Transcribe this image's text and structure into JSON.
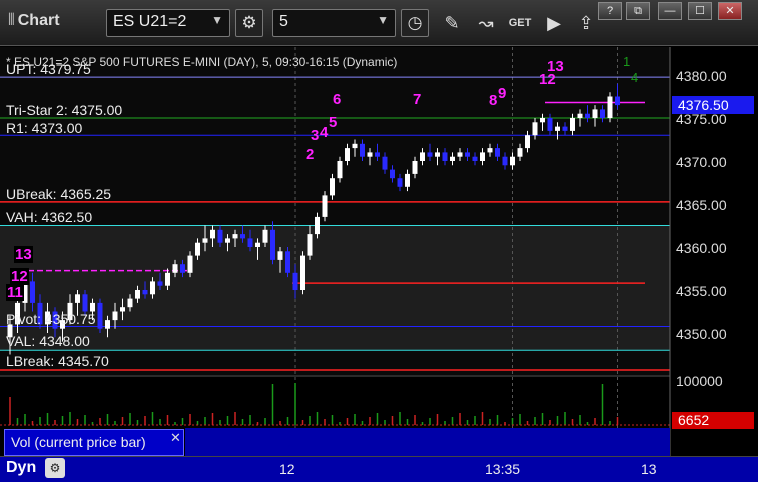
{
  "window": {
    "title": "Chart",
    "title_icon": "columns-icon",
    "controls": [
      "?",
      "⧉",
      "—",
      "☐",
      "✕"
    ]
  },
  "toolbar": {
    "symbol": "ES U21=2",
    "interval": "5",
    "icons": [
      "gear-icon",
      "clock-icon",
      "pencil-icon",
      "study-icon",
      "get-icon",
      "play-icon",
      "export-icon"
    ],
    "get_label": "GET"
  },
  "chart": {
    "title": "* ES U21=2  S&P 500 FUTURES E-MINI (DAY), 5, 09:30-16:15 (Dynamic)",
    "last_price": "4376.50",
    "price_ticks": [
      "4380.00",
      "4375.00",
      "4370.00",
      "4365.00",
      "4360.00",
      "4355.00",
      "4350.00"
    ],
    "levels": [
      {
        "label": "UPT: 4379.75",
        "value": 4379.75,
        "color": "#8888ff"
      },
      {
        "label": "Tri-Star 2: 4375.00",
        "value": 4375.0,
        "color": "#22aa22"
      },
      {
        "label": "R1: 4373.00",
        "value": 4373.0,
        "color": "#2222ff"
      },
      {
        "label": "UBreak: 4365.25",
        "value": 4365.25,
        "color": "#ff2222"
      },
      {
        "label": "VAH: 4362.50",
        "value": 4362.5,
        "color": "#33dddd"
      },
      {
        "label": "Pivot: 4350.75",
        "value": 4350.75,
        "color": "#2222ff"
      },
      {
        "label": "VAL: 4348.00",
        "value": 4348.0,
        "color": "#33dddd"
      },
      {
        "label": "LBreak: 4345.70",
        "value": 4345.7,
        "color": "#ff2222"
      }
    ],
    "sequence_counts": [
      {
        "text": "13",
        "style": "box"
      },
      {
        "text": "12",
        "style": "box"
      },
      {
        "text": "11",
        "style": "box"
      },
      {
        "text": "2",
        "style": "magenta"
      },
      {
        "text": "3",
        "style": "magenta"
      },
      {
        "text": "4",
        "style": "magenta"
      },
      {
        "text": "5",
        "style": "magenta"
      },
      {
        "text": "6",
        "style": "magenta"
      },
      {
        "text": "7",
        "style": "magenta"
      },
      {
        "text": "8",
        "style": "magenta"
      },
      {
        "text": "9",
        "style": "magenta"
      },
      {
        "text": "12",
        "style": "magenta"
      },
      {
        "text": "13",
        "style": "magenta"
      },
      {
        "text": "1",
        "style": "green"
      },
      {
        "text": "4",
        "style": "green"
      }
    ]
  },
  "chart_data": {
    "type": "candlestick",
    "y_unit": "price",
    "ylim": [
      4343,
      4383
    ],
    "ohlc": [
      [
        4349.5,
        4352.0,
        4347.5,
        4351.0
      ],
      [
        4351.0,
        4354.5,
        4350.0,
        4353.5
      ],
      [
        4353.5,
        4357.5,
        4352.5,
        4356.0
      ],
      [
        4356.0,
        4357.0,
        4352.5,
        4353.5
      ],
      [
        4353.5,
        4354.5,
        4350.5,
        4351.0
      ],
      [
        4351.0,
        4353.5,
        4350.0,
        4352.5
      ],
      [
        4352.5,
        4353.0,
        4349.5,
        4350.5
      ],
      [
        4350.5,
        4352.5,
        4349.0,
        4351.5
      ],
      [
        4351.5,
        4354.5,
        4351.0,
        4353.5
      ],
      [
        4353.5,
        4355.0,
        4352.0,
        4354.5
      ],
      [
        4354.5,
        4355.0,
        4352.0,
        4352.5
      ],
      [
        4352.5,
        4354.0,
        4351.5,
        4353.5
      ],
      [
        4353.5,
        4354.0,
        4350.0,
        4350.5
      ],
      [
        4350.5,
        4352.0,
        4349.5,
        4351.5
      ],
      [
        4351.5,
        4353.5,
        4350.5,
        4352.5
      ],
      [
        4352.5,
        4354.0,
        4351.5,
        4353.0
      ],
      [
        4353.0,
        4354.5,
        4352.5,
        4354.0
      ],
      [
        4354.0,
        4355.5,
        4353.5,
        4355.0
      ],
      [
        4355.0,
        4356.0,
        4354.0,
        4354.5
      ],
      [
        4354.5,
        4356.5,
        4354.0,
        4356.0
      ],
      [
        4356.0,
        4357.0,
        4355.0,
        4355.5
      ],
      [
        4355.5,
        4357.5,
        4355.0,
        4357.0
      ],
      [
        4357.0,
        4358.5,
        4356.5,
        4358.0
      ],
      [
        4358.0,
        4358.5,
        4356.5,
        4357.0
      ],
      [
        4357.0,
        4359.5,
        4356.5,
        4359.0
      ],
      [
        4359.0,
        4361.0,
        4358.5,
        4360.5
      ],
      [
        4360.5,
        4362.5,
        4359.5,
        4361.0
      ],
      [
        4361.0,
        4362.5,
        4360.0,
        4362.0
      ],
      [
        4362.0,
        4362.5,
        4360.0,
        4360.5
      ],
      [
        4360.5,
        4361.5,
        4359.5,
        4361.0
      ],
      [
        4361.0,
        4362.0,
        4360.0,
        4361.5
      ],
      [
        4361.5,
        4362.5,
        4360.5,
        4361.0
      ],
      [
        4361.0,
        4362.0,
        4359.5,
        4360.0
      ],
      [
        4360.0,
        4361.0,
        4358.5,
        4360.5
      ],
      [
        4360.5,
        4362.5,
        4360.0,
        4362.0
      ],
      [
        4362.0,
        4363.0,
        4358.0,
        4358.5
      ],
      [
        4358.5,
        4360.0,
        4357.0,
        4359.5
      ],
      [
        4359.5,
        4360.0,
        4356.5,
        4357.0
      ],
      [
        4357.0,
        4358.0,
        4354.0,
        4355.0
      ],
      [
        4355.0,
        4359.5,
        4354.5,
        4359.0
      ],
      [
        4359.0,
        4362.5,
        4358.5,
        4361.5
      ],
      [
        4361.5,
        4364.0,
        4361.0,
        4363.5
      ],
      [
        4363.5,
        4366.5,
        4363.0,
        4366.0
      ],
      [
        4366.0,
        4368.5,
        4365.5,
        4368.0
      ],
      [
        4368.0,
        4370.5,
        4367.5,
        4370.0
      ],
      [
        4370.0,
        4372.0,
        4369.5,
        4371.5
      ],
      [
        4371.5,
        4372.5,
        4370.5,
        4372.0
      ],
      [
        4372.0,
        4372.5,
        4370.0,
        4370.5
      ],
      [
        4370.5,
        4371.5,
        4369.5,
        4371.0
      ],
      [
        4371.0,
        4372.0,
        4370.0,
        4370.5
      ],
      [
        4370.5,
        4371.0,
        4368.5,
        4369.0
      ],
      [
        4369.0,
        4369.5,
        4367.5,
        4368.0
      ],
      [
        4368.0,
        4368.5,
        4366.5,
        4367.0
      ],
      [
        4367.0,
        4369.0,
        4366.5,
        4368.5
      ],
      [
        4368.5,
        4370.5,
        4368.0,
        4370.0
      ],
      [
        4370.0,
        4371.5,
        4369.5,
        4371.0
      ],
      [
        4371.0,
        4372.0,
        4370.0,
        4370.5
      ],
      [
        4370.5,
        4371.5,
        4369.5,
        4371.0
      ],
      [
        4371.0,
        4371.5,
        4369.5,
        4370.0
      ],
      [
        4370.0,
        4371.0,
        4369.5,
        4370.5
      ],
      [
        4370.5,
        4371.5,
        4370.0,
        4371.0
      ],
      [
        4371.0,
        4371.5,
        4370.0,
        4370.5
      ],
      [
        4370.5,
        4371.0,
        4369.5,
        4370.0
      ],
      [
        4370.0,
        4371.5,
        4369.5,
        4371.0
      ],
      [
        4371.0,
        4372.0,
        4370.5,
        4371.5
      ],
      [
        4371.5,
        4372.0,
        4370.0,
        4370.5
      ],
      [
        4370.5,
        4371.0,
        4369.0,
        4369.5
      ],
      [
        4369.5,
        4371.0,
        4369.0,
        4370.5
      ],
      [
        4370.5,
        4372.0,
        4370.0,
        4371.5
      ],
      [
        4371.5,
        4373.5,
        4371.0,
        4373.0
      ],
      [
        4373.0,
        4375.0,
        4372.5,
        4374.5
      ],
      [
        4374.5,
        4375.5,
        4373.5,
        4375.0
      ],
      [
        4375.0,
        4375.5,
        4373.0,
        4373.5
      ],
      [
        4373.5,
        4374.5,
        4372.5,
        4374.0
      ],
      [
        4374.0,
        4374.5,
        4373.0,
        4373.5
      ],
      [
        4373.5,
        4375.5,
        4373.0,
        4375.0
      ],
      [
        4375.0,
        4376.0,
        4374.0,
        4375.5
      ],
      [
        4375.5,
        4376.5,
        4374.5,
        4375.0
      ],
      [
        4375.0,
        4376.5,
        4374.0,
        4376.0
      ],
      [
        4376.0,
        4376.5,
        4374.5,
        4375.0
      ],
      [
        4375.0,
        4378.0,
        4374.5,
        4377.5
      ],
      [
        4377.5,
        4379.0,
        4376.0,
        4376.5
      ]
    ],
    "volume_ticks": [
      "100000"
    ],
    "volume_last": "6652",
    "x_ticks": [
      {
        "label": "12",
        "index": 38
      },
      {
        "label": "13:35",
        "index": 67
      },
      {
        "label": "13",
        "index": 81
      }
    ]
  },
  "volume_pane": {
    "tab_label": "Vol (current price bar)",
    "close_glyph": "✕"
  },
  "status": {
    "mode": "Dyn",
    "mode_icon": "chart-settings-icon"
  }
}
